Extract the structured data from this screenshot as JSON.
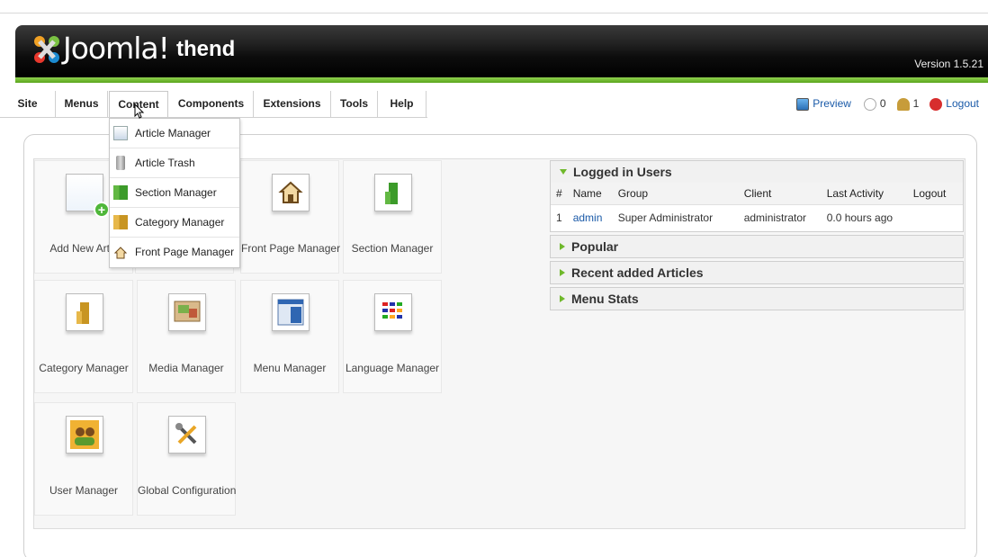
{
  "header": {
    "logo_text": "Joomla!",
    "site_name": "thend",
    "version": "Version 1.5.21"
  },
  "menubar": {
    "items": [
      "Site",
      "Menus",
      "Content",
      "Components",
      "Extensions",
      "Tools",
      "Help"
    ],
    "active": "Content",
    "preview_label": "Preview",
    "messages_count": "0",
    "users_count": "1",
    "logout_label": "Logout"
  },
  "dropdown": {
    "items": [
      "Article Manager",
      "Article Trash",
      "Section Manager",
      "Category Manager",
      "Front Page Manager"
    ]
  },
  "cpanel": {
    "tiles": [
      "Add New Article",
      "Article Manager",
      "Front Page Manager",
      "Section Manager",
      "Category Manager",
      "Media Manager",
      "Menu Manager",
      "Language Manager",
      "User Manager",
      "Global Configuration"
    ],
    "visible_tile_labels": {
      "add_new": "Add New Artic"
    }
  },
  "modules": {
    "logged_in_title": "Logged in Users",
    "columns": [
      "#",
      "Name",
      "Group",
      "Client",
      "Last Activity",
      "Logout"
    ],
    "rows": [
      {
        "num": "1",
        "name": "admin",
        "group": "Super Administrator",
        "client": "administrator",
        "activity": "0.0 hours ago",
        "logout": ""
      }
    ],
    "popular_title": "Popular",
    "recent_title": "Recent added Articles",
    "menu_stats_title": "Menu Stats"
  },
  "colors": {
    "accent_green": "#6fb82b",
    "link_blue": "#1a5aa8",
    "header_black": "#000000"
  }
}
